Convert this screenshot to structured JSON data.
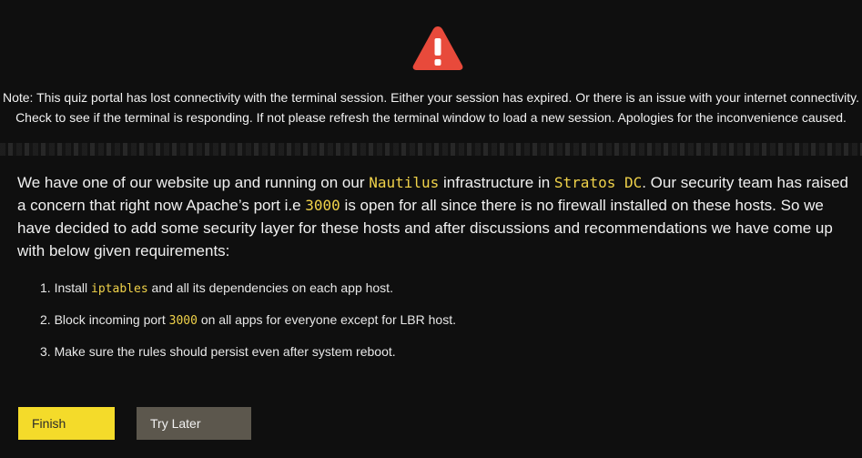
{
  "alert": {
    "icon": "warning-triangle-icon",
    "icon_color": "#e84a3b",
    "note_line1": "Note: This quiz portal has lost connectivity with the terminal session. Either your session has expired. Or there is an issue with your internet connectivity.",
    "note_line2": "Check to see if the terminal is responding. If not please refresh the terminal window to load a new session. Apologies for the inconvenience caused."
  },
  "task": {
    "intro_1": "We have one of our website up and running on our ",
    "infra_name": "Nautilus",
    "intro_2": " infrastructure in ",
    "dc_name": "Stratos DC",
    "intro_3": ". Our security team has raised a concern that right now Apache’s port i.e ",
    "port": "3000",
    "intro_4": " is open for all since there is no firewall installed on these hosts. So we have decided to add some security layer for these hosts and after discussions and recommendations we have come up with below given requirements:",
    "requirements": [
      {
        "prefix": "1. Install ",
        "code": "iptables",
        "suffix": " and all its dependencies on each app host."
      },
      {
        "prefix": "2. Block incoming port ",
        "code": "3000",
        "suffix": " on all apps for everyone except for LBR host."
      },
      {
        "prefix": "3. Make sure the rules should persist even after system reboot.",
        "code": "",
        "suffix": ""
      }
    ]
  },
  "buttons": {
    "finish_label": "Finish",
    "try_later_label": "Try Later"
  },
  "colors": {
    "accent_yellow": "#f4db2a",
    "code_yellow": "#f0d24a",
    "secondary_button": "#5c574d",
    "background": "#0f0f0f"
  }
}
